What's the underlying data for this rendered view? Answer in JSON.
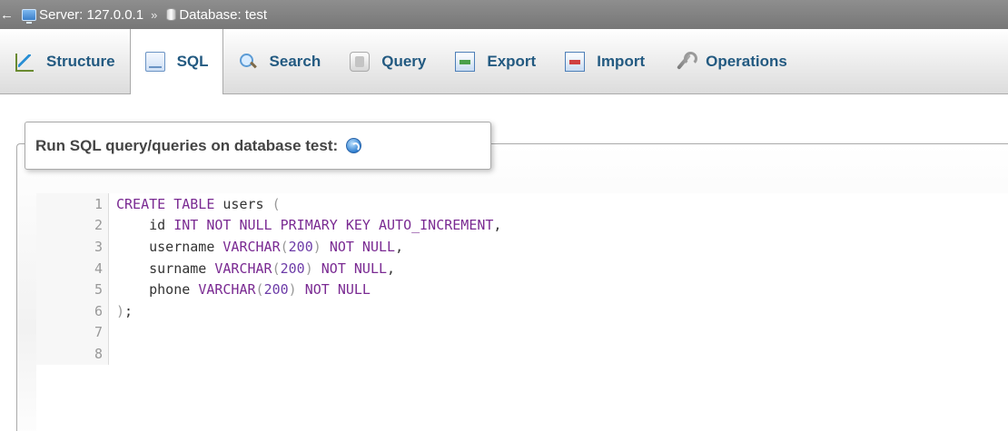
{
  "breadcrumb": {
    "back_arrow": "←",
    "server_label": "Server: 127.0.0.1",
    "separator": "»",
    "database_label": "Database: test"
  },
  "tabs": [
    {
      "label": "Structure",
      "icon": "structure-icon"
    },
    {
      "label": "SQL",
      "icon": "sql-icon",
      "active": true
    },
    {
      "label": "Search",
      "icon": "search-icon"
    },
    {
      "label": "Query",
      "icon": "query-icon"
    },
    {
      "label": "Export",
      "icon": "export-icon"
    },
    {
      "label": "Import",
      "icon": "import-icon"
    },
    {
      "label": "Operations",
      "icon": "operations-icon"
    }
  ],
  "panel": {
    "legend": "Run SQL query/queries on database test:",
    "help_icon": "help-icon"
  },
  "editor": {
    "line_numbers": [
      "1",
      "2",
      "3",
      "4",
      "5",
      "6",
      "7",
      "8"
    ],
    "lines": [
      [
        {
          "t": "kw",
          "v": "CREATE TABLE"
        },
        {
          "t": "p",
          "v": " users "
        },
        {
          "t": "paren",
          "v": "("
        }
      ],
      [
        {
          "t": "p",
          "v": "    id "
        },
        {
          "t": "kw",
          "v": "INT NOT NULL PRIMARY KEY AUTO_INCREMENT"
        },
        {
          "t": "p",
          "v": ","
        }
      ],
      [
        {
          "t": "p",
          "v": "    username "
        },
        {
          "t": "kw",
          "v": "VARCHAR"
        },
        {
          "t": "paren",
          "v": "("
        },
        {
          "t": "num",
          "v": "200"
        },
        {
          "t": "paren",
          "v": ")"
        },
        {
          "t": "p",
          "v": " "
        },
        {
          "t": "kw",
          "v": "NOT NULL"
        },
        {
          "t": "p",
          "v": ","
        }
      ],
      [
        {
          "t": "p",
          "v": "    surname "
        },
        {
          "t": "kw",
          "v": "VARCHAR"
        },
        {
          "t": "paren",
          "v": "("
        },
        {
          "t": "num",
          "v": "200"
        },
        {
          "t": "paren",
          "v": ")"
        },
        {
          "t": "p",
          "v": " "
        },
        {
          "t": "kw",
          "v": "NOT NULL"
        },
        {
          "t": "p",
          "v": ","
        }
      ],
      [
        {
          "t": "p",
          "v": "    phone "
        },
        {
          "t": "kw",
          "v": "VARCHAR"
        },
        {
          "t": "paren",
          "v": "("
        },
        {
          "t": "num",
          "v": "200"
        },
        {
          "t": "paren",
          "v": ")"
        },
        {
          "t": "p",
          "v": " "
        },
        {
          "t": "kw",
          "v": "NOT NULL"
        }
      ],
      [
        {
          "t": "paren",
          "v": ")"
        },
        {
          "t": "p",
          "v": ";"
        }
      ],
      [],
      []
    ]
  },
  "colors": {
    "tab_text": "#235a81",
    "keyword": "#7a2a92",
    "number": "#6d3ca8",
    "breadcrumb_bg": "#808080"
  }
}
